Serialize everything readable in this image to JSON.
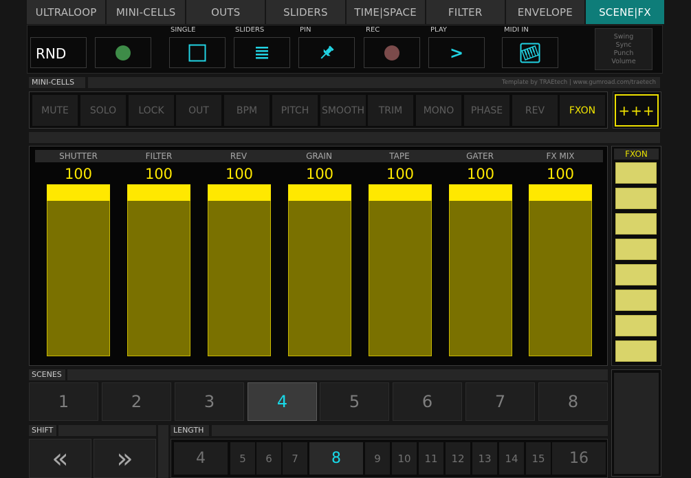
{
  "tabs": [
    {
      "label": "ULTRALOOP",
      "active": false
    },
    {
      "label": "MINI-CELLS",
      "active": false
    },
    {
      "label": "OUTS",
      "active": false
    },
    {
      "label": "SLIDERS",
      "active": false
    },
    {
      "label": "TIME|SPACE",
      "active": false
    },
    {
      "label": "FILTER",
      "active": false
    },
    {
      "label": "ENVELOPE",
      "active": false
    },
    {
      "label": "SCENE|FX",
      "active": true
    }
  ],
  "controls": {
    "rnd_label": "RND",
    "single_label": "SINGLE",
    "sliders_label": "SLIDERS",
    "pin_label": "PIN",
    "rec_label": "REC",
    "play_label": "PLAY",
    "play_symbol": ">",
    "midi_in_label": "MIDI IN",
    "info_lines": [
      "Swing",
      "Sync",
      "Punch",
      "Volume"
    ],
    "icons": {
      "green_dot": "green-circle-icon",
      "single": "square-icon",
      "sliders": "bars-icon",
      "pin": "pushpin-icon",
      "rec": "record-circle-icon",
      "midi": "piano-keyboard-icon"
    }
  },
  "minicells": {
    "section_label": "MINI-CELLS",
    "credit": "Template by TRAEtech  |  www.gumroad.com/traetech",
    "cells": [
      "MUTE",
      "SOLO",
      "LOCK",
      "OUT",
      "BPM",
      "PITCH",
      "SMOOTH",
      "TRIM",
      "MONO",
      "PHASE",
      "REV",
      "FXON"
    ],
    "active_cell": "FXON",
    "plus_label": "+++"
  },
  "faders": [
    {
      "name": "SHUTTER",
      "value": "100",
      "level": 1.0
    },
    {
      "name": "FILTER",
      "value": "100",
      "level": 1.0
    },
    {
      "name": "REV",
      "value": "100",
      "level": 1.0
    },
    {
      "name": "GRAIN",
      "value": "100",
      "level": 1.0
    },
    {
      "name": "TAPE",
      "value": "100",
      "level": 1.0
    },
    {
      "name": "GATER",
      "value": "100",
      "level": 1.0
    },
    {
      "name": "FX MIX",
      "value": "100",
      "level": 1.0
    }
  ],
  "fx_panel": {
    "title": "FXON",
    "pad_count": 8
  },
  "scenes": {
    "section_label": "SCENES",
    "items": [
      "1",
      "2",
      "3",
      "4",
      "5",
      "6",
      "7",
      "8"
    ],
    "active": "4"
  },
  "shift": {
    "section_label": "SHIFT",
    "left_symbol": "«",
    "right_symbol": "»"
  },
  "length": {
    "section_label": "LENGTH",
    "items": [
      "4",
      "5",
      "6",
      "7",
      "8",
      "9",
      "10",
      "11",
      "12",
      "13",
      "14",
      "15",
      "16"
    ],
    "active": "8"
  },
  "colors": {
    "accent_teal": "#0e7d79",
    "cyan_text": "#18d9e8",
    "fader_yellow": "#ffe800",
    "fader_fill": "#7a7100",
    "fx_pad": "#d9d46a"
  }
}
